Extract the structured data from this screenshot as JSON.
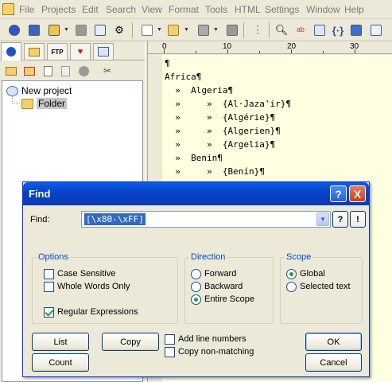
{
  "menubar": {
    "items": [
      "File",
      "Projects",
      "Edit",
      "Search",
      "View",
      "Format",
      "Tools",
      "HTML",
      "Settings",
      "Window",
      "Help"
    ]
  },
  "left_panel": {
    "tabs": [
      "project-tab",
      "folder-tab",
      "ftp-tab",
      "favorites-tab",
      "library-tab"
    ],
    "tree": {
      "project": "New project",
      "folder": "Folder"
    }
  },
  "editor": {
    "ruler_labels": [
      "0",
      "10",
      "20",
      "30"
    ],
    "lines": [
      "¶",
      "Africa¶",
      "  »  Algeria¶",
      "  »     »  {Al·Jaza'ir}¶",
      "  »     »  {Algérie}¶",
      "  »     »  {Algerien}¶",
      "  »     »  {Argelia}¶",
      "  »  Benin¶",
      "  »     »  {Benín}¶"
    ]
  },
  "find_dialog": {
    "title": "Find",
    "find_label": "Find:",
    "find_value": "[\\x80-\\xFF]",
    "help_button": "?",
    "close_button": "X",
    "regex_help_label": "?",
    "regex_button_label": "!",
    "options": {
      "title": "Options",
      "case_sensitive": "Case Sensitive",
      "whole_words": "Whole Words Only",
      "regular_expressions": "Regular Expressions"
    },
    "direction": {
      "title": "Direction",
      "forward": "Forward",
      "backward": "Backward",
      "entire_scope": "Entire Scope"
    },
    "scope": {
      "title": "Scope",
      "global": "Global",
      "selected_text": "Selected text"
    },
    "buttons": {
      "list": "List",
      "copy": "Copy",
      "count": "Count",
      "ok": "OK",
      "cancel": "Cancel"
    },
    "extra_options": {
      "add_line_numbers": "Add line numbers",
      "copy_non_matching": "Copy non-matching"
    },
    "state": {
      "case_sensitive": false,
      "whole_words": false,
      "regular_expressions": true,
      "direction": "Entire Scope",
      "scope": "Global",
      "add_line_numbers": false,
      "copy_non_matching": false
    }
  }
}
